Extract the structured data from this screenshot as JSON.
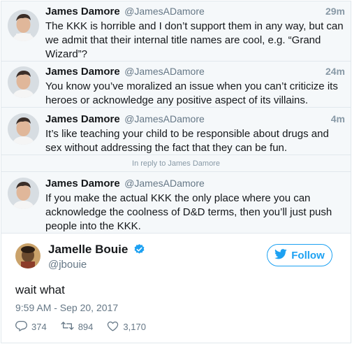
{
  "thread": [
    {
      "name": "James Damore",
      "handle": "@JamesADamore",
      "time": "29m",
      "text": "The KKK is horrible and I don’t support them in any way, but can we admit that their internal title names are cool, e.g. “Grand Wizard”?"
    },
    {
      "name": "James Damore",
      "handle": "@JamesADamore",
      "time": "24m",
      "text": "You know you’ve moralized an issue when you can’t criticize its heroes or acknowledge any positive aspect of its villains."
    },
    {
      "name": "James Damore",
      "handle": "@JamesADamore",
      "time": "4m",
      "text": "It’s like teaching your child to be responsible about drugs and sex without addressing the fact that they can be fun."
    }
  ],
  "reply_bar": "In reply to James Damore",
  "reply": {
    "name": "James Damore",
    "handle": "@JamesADamore",
    "text": "If you make the actual KKK the only place where you can acknowledge the coolness of D&D terms, then you’ll just push people into the KKK."
  },
  "main": {
    "name": "Jamelle Bouie",
    "handle": "@jbouie",
    "follow_label": "Follow",
    "text": "wait what",
    "date": "9:59 AM - Sep 20, 2017",
    "replies": "374",
    "retweets": "894",
    "likes": "3,170"
  },
  "colors": {
    "accent": "#1da1f2",
    "secondary_text": "#657786",
    "thread_bg": "#f5f8fa"
  }
}
